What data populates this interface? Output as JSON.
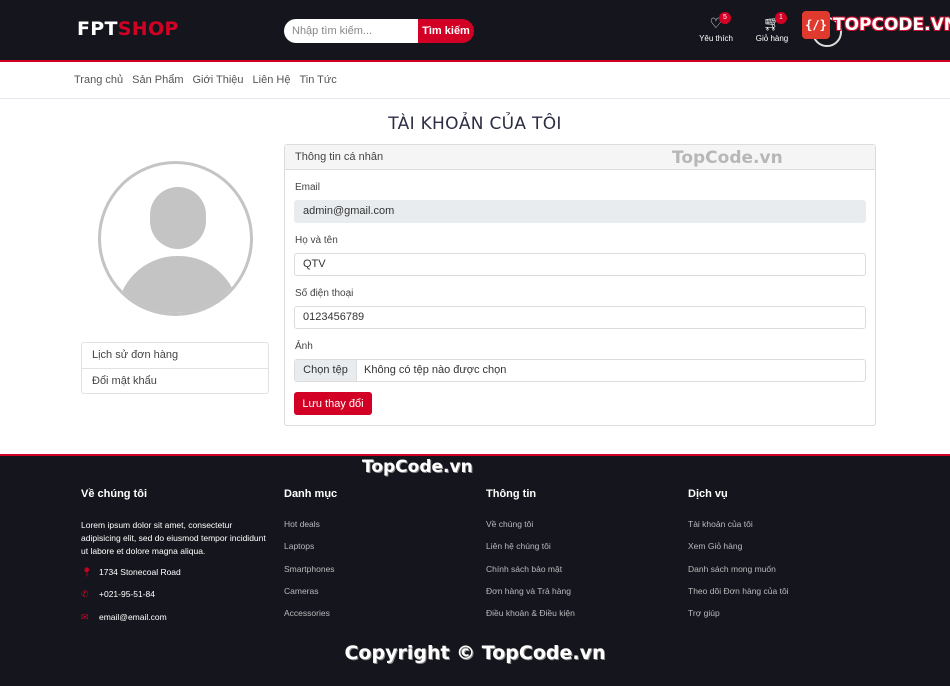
{
  "header": {
    "logo_part1": "FPT",
    "logo_part2": "SHOP",
    "search_placeholder": "Nhập tìm kiếm...",
    "search_button": "Tìm kiếm",
    "wishlist": {
      "label": "Yêu thích",
      "count": "5",
      "icon": "heart-icon"
    },
    "cart": {
      "label": "Giỏ hàng",
      "count": "1",
      "icon": "cart-icon"
    },
    "brand_box": "{/}",
    "brand_text": "TOPCODE.VN"
  },
  "nav": [
    "Trang chủ",
    "Sản Phẩm",
    "Giới Thiệu",
    "Liên Hệ",
    "Tin Tức"
  ],
  "main": {
    "title": "TÀI KHOẢN CỦA TÔI",
    "side_menu": [
      "Lịch sử đơn hàng",
      "Đổi mật khẩu"
    ],
    "card_title": "Thông tin cá nhân",
    "email_label": "Email",
    "email_value": "admin@gmail.com",
    "name_label": "Họ và tên",
    "name_value": "QTV",
    "phone_label": "Số điện thoại",
    "phone_value": "0123456789",
    "image_label": "Ảnh",
    "file_button": "Chọn tệp",
    "file_status": "Không có tệp nào được chọn",
    "save_button": "Lưu thay đổi",
    "watermark": "TopCode.vn"
  },
  "footer": {
    "about": {
      "title": "Về chúng tôi",
      "text": "Lorem ipsum dolor sit amet, consectetur adipisicing elit, sed do eiusmod tempor incididunt ut labore et dolore magna aliqua.",
      "address": "1734 Stonecoal Road",
      "phone": "+021-95-51-84",
      "email": "email@email.com"
    },
    "categories": {
      "title": "Danh mục",
      "links": [
        "Hot deals",
        "Laptops",
        "Smartphones",
        "Cameras",
        "Accessories"
      ]
    },
    "info": {
      "title": "Thông tin",
      "links": [
        "Về chúng tôi",
        "Liên hệ chúng tôi",
        "Chính sách bảo mật",
        "Đơn hàng và Trả hàng",
        "Điều khoản & Điều kiện"
      ]
    },
    "service": {
      "title": "Dịch vụ",
      "links": [
        "Tài khoản của tôi",
        "Xem Giỏ hàng",
        "Danh sách mong muốn",
        "Theo dõi Đơn hàng của tôi",
        "Trợ giúp"
      ]
    },
    "watermark": "TopCode.vn",
    "copyright": "Copyright © TopCode.vn"
  },
  "colors": {
    "primary": "#d10024",
    "dark": "#15161d"
  }
}
